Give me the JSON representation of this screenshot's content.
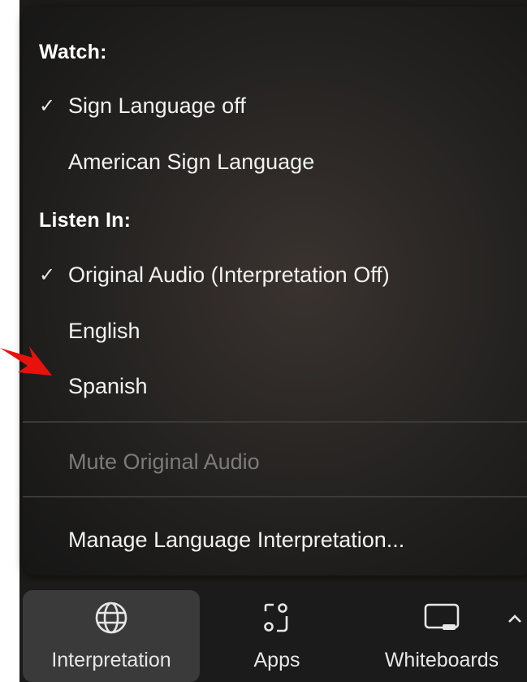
{
  "menu": {
    "watch_label": "Watch:",
    "watch_items": [
      {
        "label": "Sign Language off",
        "checked": true
      },
      {
        "label": "American Sign Language",
        "checked": false
      }
    ],
    "listen_label": "Listen In:",
    "listen_items": [
      {
        "label": "Original Audio (Interpretation Off)",
        "checked": true
      },
      {
        "label": "English",
        "checked": false
      },
      {
        "label": "Spanish",
        "checked": false
      }
    ],
    "mute_label": "Mute Original Audio",
    "manage_label": "Manage Language Interpretation...",
    "check_glyph": "✓"
  },
  "toolbar": {
    "items": [
      {
        "label": "Interpretation",
        "icon": "globe-icon",
        "active": true
      },
      {
        "label": "Apps",
        "icon": "apps-icon",
        "active": false
      },
      {
        "label": "Whiteboards",
        "icon": "whiteboard-icon",
        "active": false
      }
    ],
    "caret_icon": "caret-up-icon"
  },
  "colors": {
    "menu_text": "#f2f2f2",
    "disabled_text": "#7d7b79",
    "arrow": "#e8120c",
    "toolbar_bg": "#1b1b1b",
    "active_bg": "#3a3a3a"
  }
}
